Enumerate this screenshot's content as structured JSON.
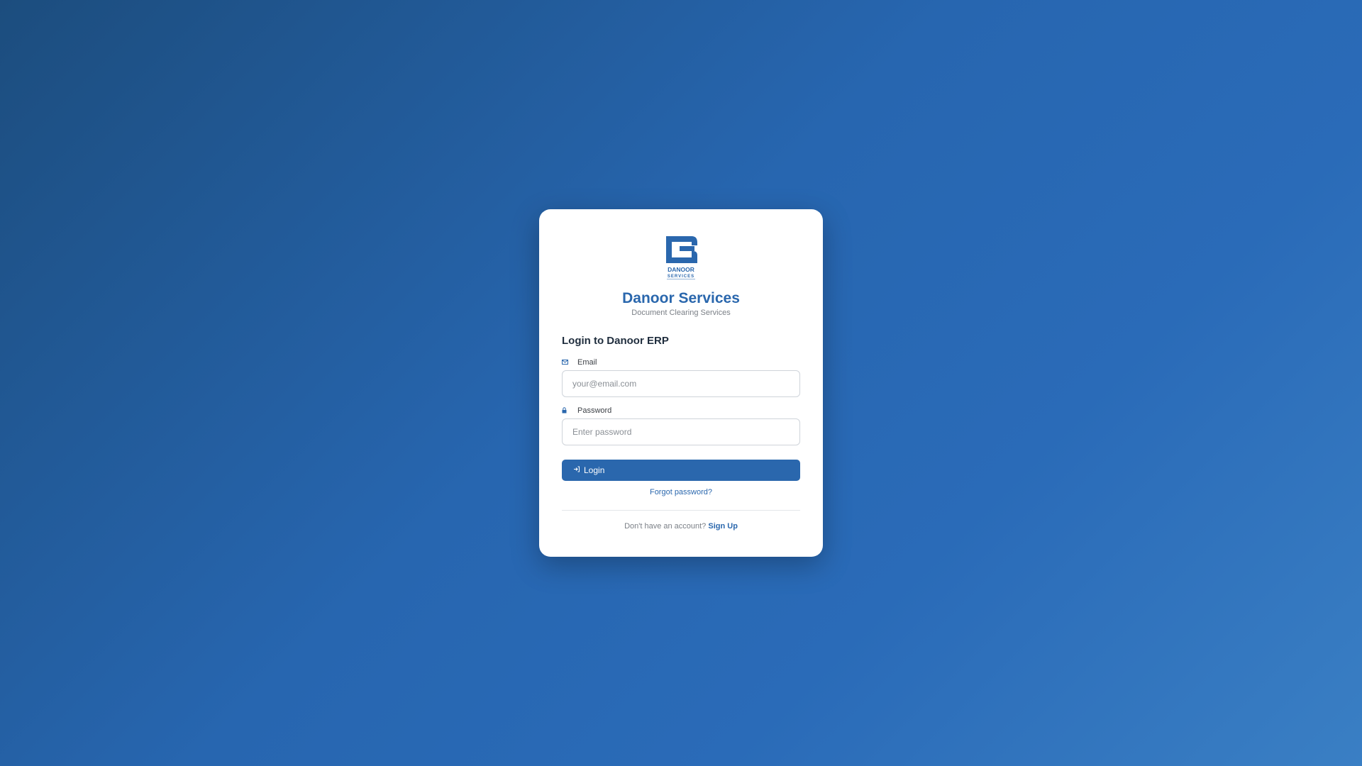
{
  "brand": {
    "logo_text_line1": "DANOOR",
    "logo_text_line2": "SERVICES",
    "name": "Danoor Services",
    "tagline": "Document Clearing Services",
    "accent_color": "#2a67ad"
  },
  "form": {
    "heading": "Login to Danoor ERP",
    "email": {
      "icon": "envelope-icon",
      "label": "Email",
      "placeholder": "your@email.com",
      "value": ""
    },
    "password": {
      "icon": "lock-icon",
      "label": "Password",
      "placeholder": "Enter password",
      "value": ""
    },
    "login_button": {
      "icon": "sign-in-icon",
      "label": "Login"
    },
    "forgot_password": "Forgot password?",
    "signup_prompt": "Don't have an account?",
    "signup_link": "Sign Up"
  }
}
